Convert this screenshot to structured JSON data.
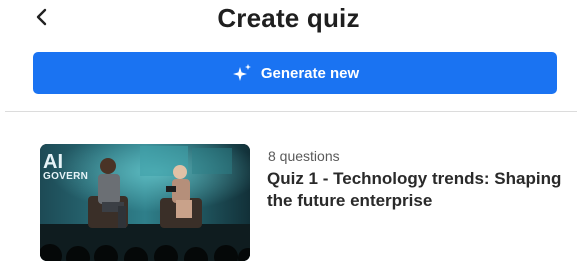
{
  "header": {
    "back_icon": "chevron-left-icon",
    "title": "Create quiz"
  },
  "generate_button": {
    "icon": "sparkles-icon",
    "label": "Generate new",
    "color": "#1a73f2"
  },
  "quizzes": [
    {
      "thumbnail": {
        "description_icon": "panel-discussion-image",
        "overlay_text_big": "AI",
        "overlay_text_small": "GOVERN"
      },
      "question_count": "8 questions",
      "title": "Quiz 1 - Technology trends: Shaping the future enterprise"
    }
  ]
}
